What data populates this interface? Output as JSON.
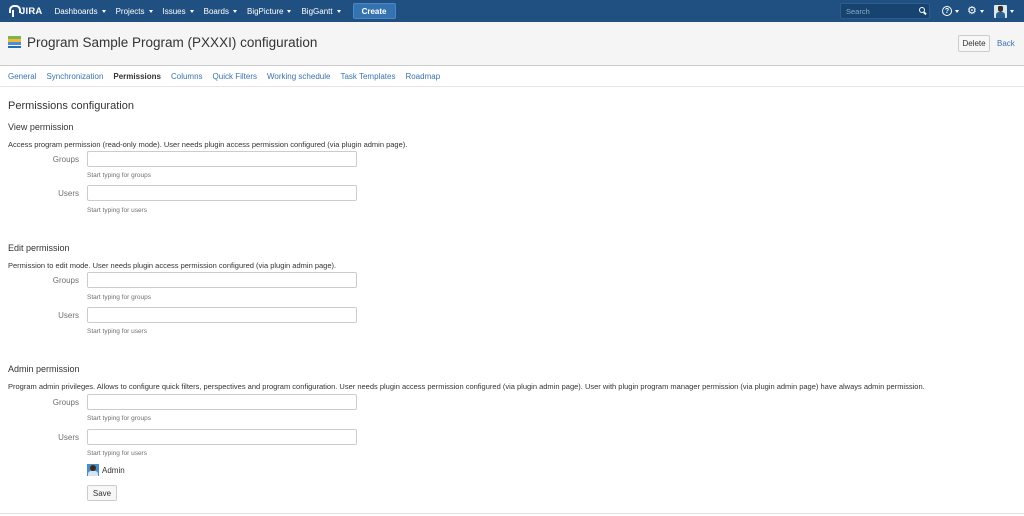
{
  "topnav": {
    "logo_text": "JIRA",
    "items": [
      {
        "label": "Dashboards"
      },
      {
        "label": "Projects"
      },
      {
        "label": "Issues"
      },
      {
        "label": "Boards"
      },
      {
        "label": "BigPicture"
      },
      {
        "label": "BigGantt"
      }
    ],
    "create_label": "Create",
    "search_placeholder": "Search",
    "help_glyph": "?",
    "gear_glyph": "⚙",
    "bar_color": "#205081"
  },
  "header": {
    "title": "Program Sample Program (PXXXI) configuration",
    "delete_label": "Delete",
    "back_label": "Back",
    "icon": "program-icon"
  },
  "tabs": [
    {
      "label": "General",
      "active": false
    },
    {
      "label": "Synchronization",
      "active": false
    },
    {
      "label": "Permissions",
      "active": true
    },
    {
      "label": "Columns",
      "active": false
    },
    {
      "label": "Quick Filters",
      "active": false
    },
    {
      "label": "Working schedule",
      "active": false
    },
    {
      "label": "Task Templates",
      "active": false
    },
    {
      "label": "Roadmap",
      "active": false
    }
  ],
  "content": {
    "heading": "Permissions configuration",
    "sections": [
      {
        "title": "View permission",
        "description": "Access program permission (read-only mode). User needs plugin access permission configured (via plugin admin page).",
        "groups_label": "Groups",
        "groups_value": "",
        "groups_hint": "Start typing for groups",
        "users_label": "Users",
        "users_value": "",
        "users_hint": "Start typing for users"
      },
      {
        "title": "Edit permission",
        "description": "Permission to edit mode. User needs plugin access permission configured (via plugin admin page).",
        "groups_label": "Groups",
        "groups_value": "",
        "groups_hint": "Start typing for groups",
        "users_label": "Users",
        "users_value": "",
        "users_hint": "Start typing for users"
      },
      {
        "title": "Admin permission",
        "description": "Program admin privileges. Allows to configure quick filters, perspectives and program configuration. User needs plugin access permission configured (via plugin admin page). User with plugin program manager permission (via plugin admin page) have always admin permission.",
        "groups_label": "Groups",
        "groups_value": "",
        "groups_hint": "Start typing for groups",
        "users_label": "Users",
        "users_value": "",
        "users_hint": "Start typing for users",
        "selected_user": "Admin"
      }
    ],
    "save_label": "Save"
  },
  "colors": {
    "link": "#3b73af",
    "create_button": "#3572b0",
    "header_bg": "#f5f5f5"
  }
}
